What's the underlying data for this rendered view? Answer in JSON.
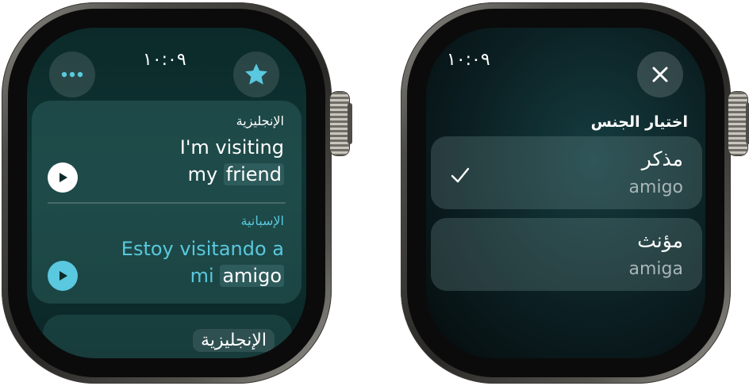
{
  "colors": {
    "accent": "#5ac8de",
    "highlight": "#2e5b5b",
    "button_bg": "#3a4a4c"
  },
  "left_watch": {
    "time": "١٠:٠٩",
    "more_icon": "ellipsis-icon",
    "favorite_icon": "star-icon",
    "source": {
      "language": "الإنجليزية",
      "line1": "I'm visiting",
      "line2_prefix": "my ",
      "line2_highlight": "friend"
    },
    "target": {
      "language": "الإسبانية",
      "line1": "Estoy visitando a",
      "line2_prefix": "mi ",
      "line2_highlight": "amigo"
    },
    "language_button": "الإنجليزية"
  },
  "right_watch": {
    "time": "١٠:٠٩",
    "close_icon": "close-icon",
    "heading": "اختيار الجنس",
    "options": [
      {
        "label": "مذكر",
        "word": "amigo",
        "selected": true
      },
      {
        "label": "مؤنث",
        "word": "amiga",
        "selected": false
      }
    ],
    "check_icon": "checkmark-icon"
  }
}
